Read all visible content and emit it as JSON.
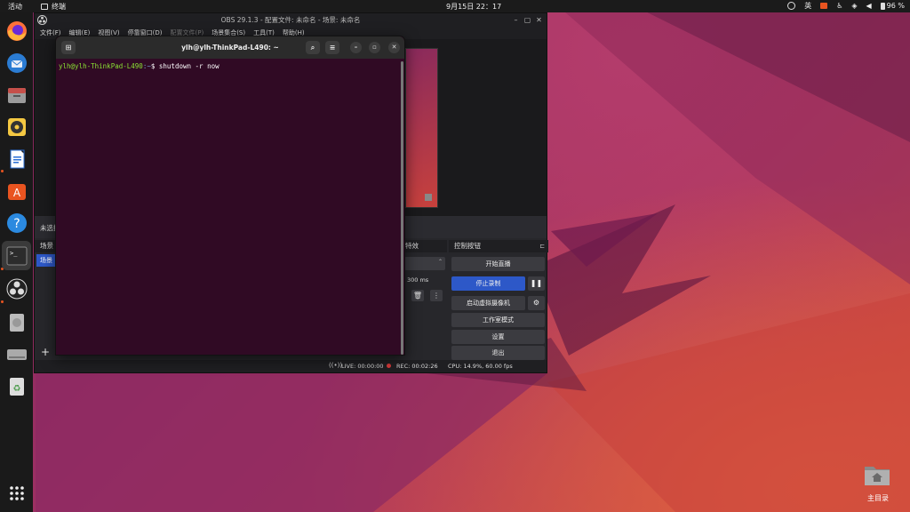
{
  "topbar": {
    "activities": "活动",
    "app_name": "终端",
    "clock": "9月15日  22：17",
    "input_method": "英",
    "battery": "96 %"
  },
  "obs": {
    "title": "OBS 29.1.3 - 配置文件: 未命名 - 场景: 未命名",
    "menu": [
      "文件(F)",
      "编辑(E)",
      "视图(V)",
      "停靠窗口(D)",
      "配置文件(P)",
      "场景集合(S)",
      "工具(T)",
      "帮助(H)"
    ],
    "no_source": "未选择",
    "scenes_header": "场景",
    "scene_item": "场景",
    "add_label": "+",
    "partial_header": "特效",
    "duration": "300 ms",
    "controls_header": "控制按钮",
    "controls": {
      "start_stream": "开始直播",
      "stop_record": "停止录制",
      "virtual_cam": "启动虚拟摄像机",
      "studio_mode": "工作室模式",
      "settings": "设置",
      "exit": "退出"
    },
    "status": {
      "live": "LIVE: 00:00:00",
      "rec": "REC: 00:02:26",
      "cpu": "CPU: 14.9%, 60.00 fps"
    }
  },
  "terminal": {
    "title": "ylh@ylh-ThinkPad-L490: ~",
    "prompt_user": "ylh@ylh-ThinkPad-L490",
    "prompt_path": ":~",
    "command": "$ shutdown -r now"
  },
  "desktop": {
    "home_label": "主目录"
  },
  "colors": {
    "accent": "#e95420",
    "terminal_bg": "#300a24",
    "obs_blue": "#2d58c8"
  }
}
